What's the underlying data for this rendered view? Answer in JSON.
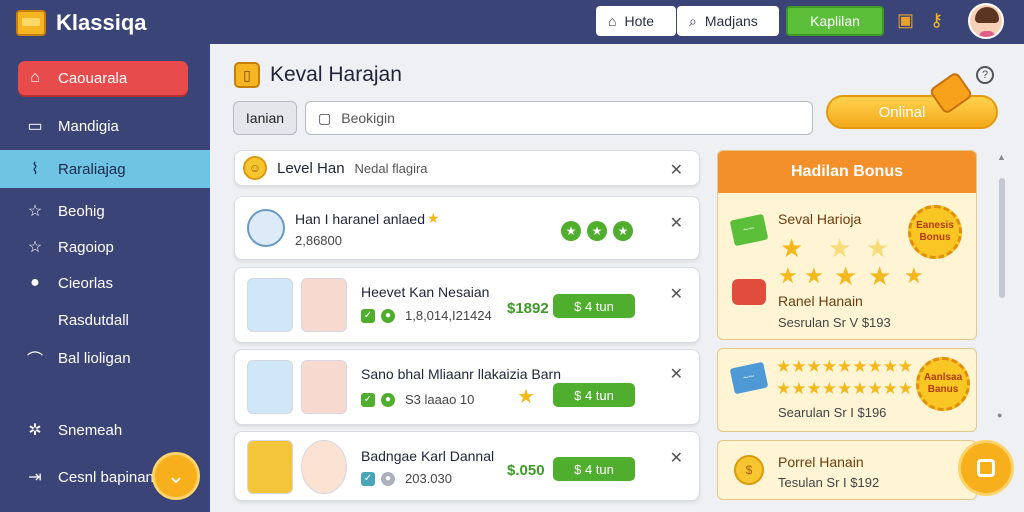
{
  "app": {
    "name": "Klassiqa"
  },
  "topbar": {
    "home_label": "Hote",
    "search_label": "Madjans",
    "action_label": "Kaplilan"
  },
  "sidebar": {
    "items": [
      {
        "label": "Caouarala"
      },
      {
        "label": "Mandigia"
      },
      {
        "label": "Raraliajag"
      },
      {
        "label": "Beohig"
      },
      {
        "label": "Ragoiop"
      },
      {
        "label": "Cieorlas"
      },
      {
        "label": "Rasdutdall"
      },
      {
        "label": "Bal lioligan"
      },
      {
        "label": "Snemeah"
      },
      {
        "label": "Cesnl bapinan"
      }
    ]
  },
  "header": {
    "title": "Keval Harajan",
    "filter_label": "Ianian",
    "search_placeholder": "Beokigin",
    "optional_label": "Onlinal"
  },
  "level": {
    "title": "Level Han",
    "subtitle": "Nedal flagira"
  },
  "rows": [
    {
      "name": "Han I haranel anlaed",
      "sub": "2,86800"
    },
    {
      "name": "Heevet Kan Nesaian",
      "sub": "1,8,014,I21424",
      "price": "$1892",
      "button": "$ 4 tun"
    },
    {
      "name": "Sano bhal Mliaanr llakaizia Barn",
      "sub": "S3 laaao 10",
      "button": "$ 4 tun"
    },
    {
      "name": "Badngae Karl Dannal",
      "sub": "203.030",
      "price": "$.050",
      "button": "$ 4 tun"
    }
  ],
  "bonus": {
    "title": "Hadilan Bonus",
    "items": [
      {
        "name": "Seval Harioja",
        "seal": "Eanesis Bonus"
      },
      {
        "name": "Ranel Hanain",
        "sub": "Sesrulan Sr V $193"
      },
      {
        "sub": "Searulan Sr I $196",
        "seal": "Aanlsaa Banus"
      },
      {
        "name": "Porrel Hanain",
        "sub": "Tesulan Sr I $192"
      }
    ]
  },
  "colors": {
    "sidebar": "#3b4477",
    "active": "#e84b4b",
    "highlight": "#6fc3e3",
    "green": "#4fae2e",
    "orange": "#f4902a"
  }
}
